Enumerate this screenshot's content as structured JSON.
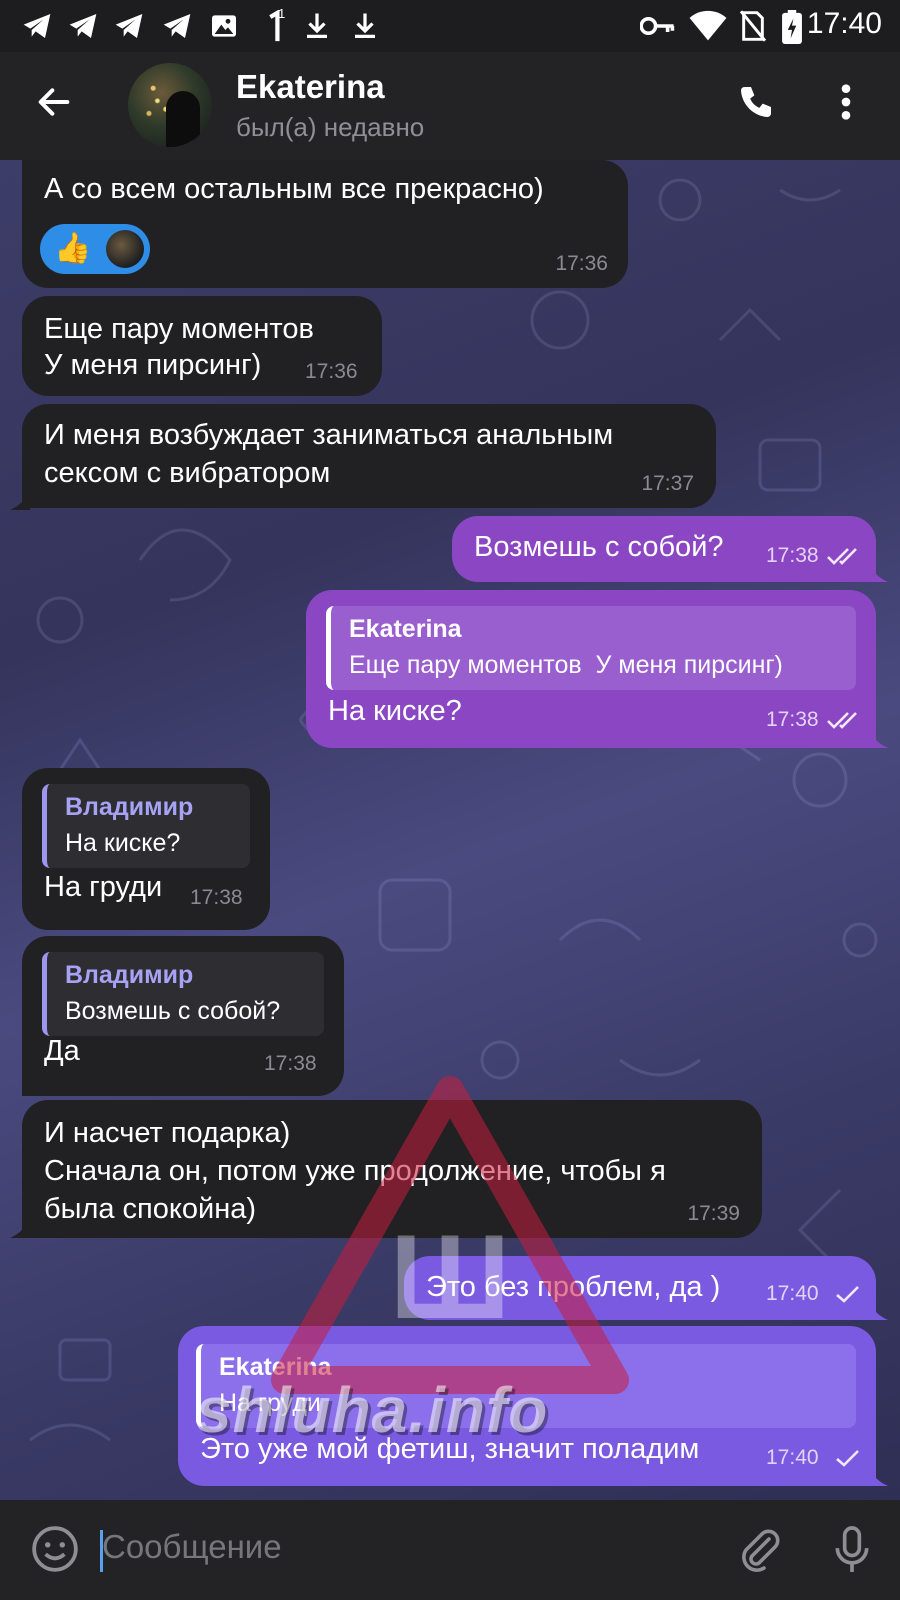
{
  "status_bar": {
    "time": "17:40",
    "notification_badge": "1"
  },
  "header": {
    "name": "Ekaterina",
    "status": "был(а) недавно"
  },
  "messages": [
    {
      "dir": "in",
      "lines": [
        "А со всем остальным все прекрасно)"
      ],
      "time": "17:36",
      "reaction": "👍"
    },
    {
      "dir": "in",
      "lines": [
        "Еще пару моментов",
        "У меня пирсинг)"
      ],
      "time": "17:36"
    },
    {
      "dir": "in",
      "lines": [
        "И меня возбуждает заниматься анальным",
        "сексом с вибратором"
      ],
      "time": "17:37"
    },
    {
      "dir": "out",
      "lines": [
        "Возмешь с собой?"
      ],
      "time": "17:38",
      "read": true
    },
    {
      "dir": "out",
      "reply": {
        "name": "Ekaterina",
        "text": "Еще пару моментов  У меня пирсинг)"
      },
      "lines": [
        "На киске?"
      ],
      "time": "17:38",
      "read": true
    },
    {
      "dir": "in",
      "reply": {
        "name": "Владимир",
        "text": "На киске?"
      },
      "lines": [
        "На груди"
      ],
      "time": "17:38"
    },
    {
      "dir": "in",
      "reply": {
        "name": "Владимир",
        "text": "Возмешь с собой?"
      },
      "lines": [
        "Да"
      ],
      "time": "17:38"
    },
    {
      "dir": "in",
      "lines": [
        "И насчет подарка)",
        "Сначала он, потом уже продолжение, чтобы я",
        "была спокойна)"
      ],
      "time": "17:39"
    },
    {
      "dir": "out",
      "lines": [
        "Это без проблем, да )"
      ],
      "time": "17:40",
      "read": false
    },
    {
      "dir": "out",
      "reply": {
        "name": "Ekaterina",
        "text": "На груди"
      },
      "lines": [
        "Это уже мой фетиш, значит поладим"
      ],
      "time": "17:40",
      "read": false
    }
  ],
  "watermark": {
    "text": "shluha.info",
    "glyph": "Ш"
  },
  "composer": {
    "placeholder": "Сообщение"
  },
  "colors": {
    "incoming": "#212124",
    "outgoing": "#8b46c4",
    "outgoing_latest": "#7a5ae0",
    "reply_name": "#a8a2f5"
  }
}
